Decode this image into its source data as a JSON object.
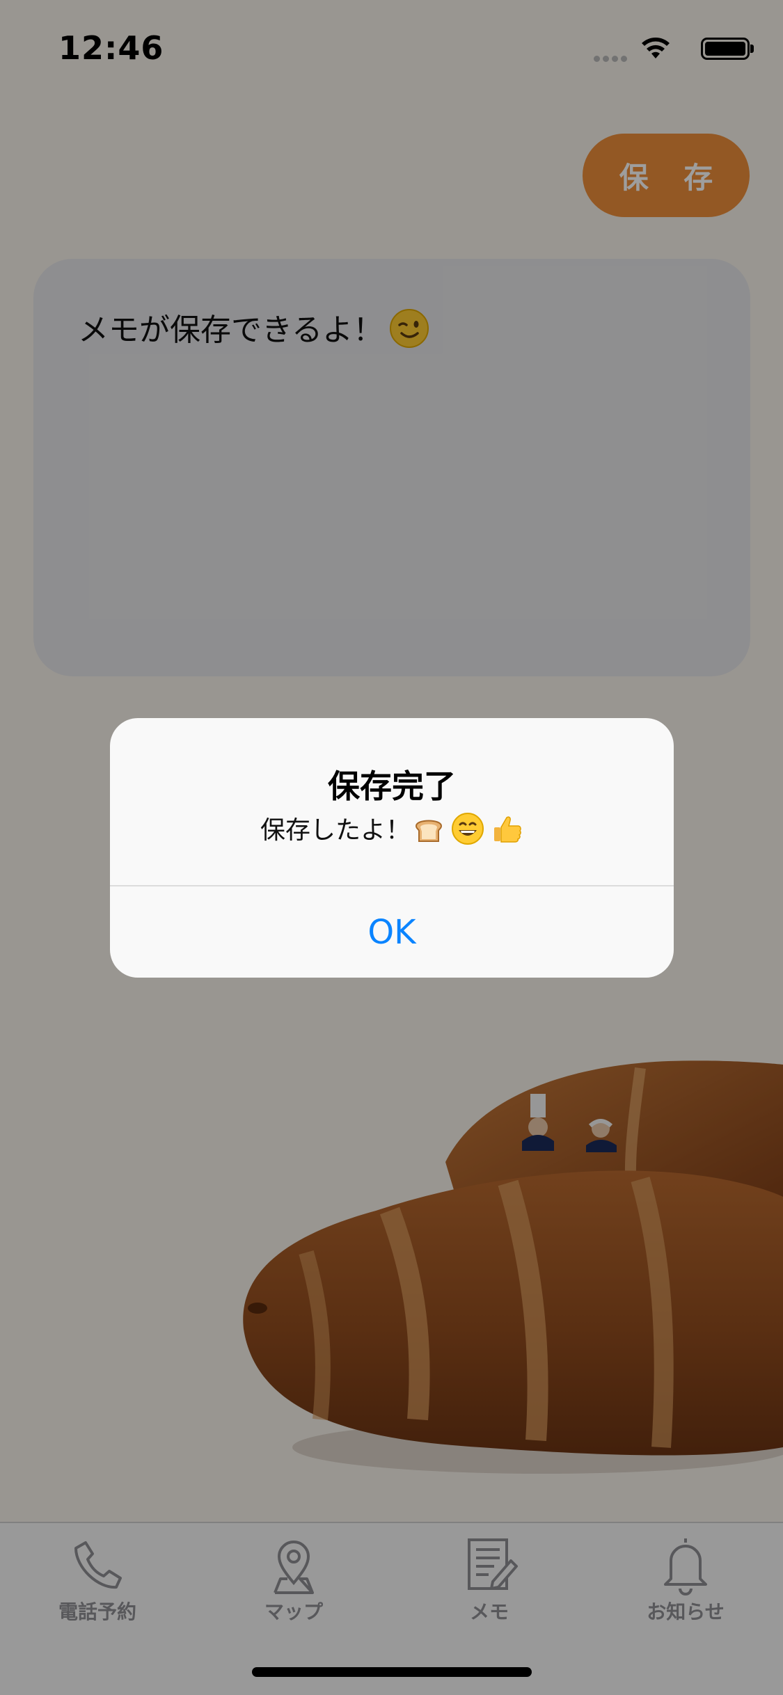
{
  "status_bar": {
    "time": "12:46",
    "icons": [
      "signal-icon",
      "wifi-icon",
      "battery-icon"
    ]
  },
  "header": {
    "save_label": "保 存"
  },
  "memo": {
    "text": "メモが保存できるよ！",
    "emoji": "winking-face-emoji"
  },
  "alert": {
    "title": "保存完了",
    "message": "保存したよ！",
    "message_emojis": [
      "bread-emoji",
      "grinning-face-emoji",
      "thumbs-up-emoji"
    ],
    "ok_label": "OK"
  },
  "tab_bar": {
    "items": [
      {
        "label": "電話予約",
        "icon": "phone-icon"
      },
      {
        "label": "マップ",
        "icon": "map-pin-icon"
      },
      {
        "label": "メモ",
        "icon": "memo-icon"
      },
      {
        "label": "お知らせ",
        "icon": "bell-icon"
      }
    ]
  },
  "colors": {
    "accent": "#ED8E3B",
    "link": "#0A84FF",
    "background": "#F7F2EA",
    "memo_box": "#E6E6E9",
    "overlay": "rgba(0,0,0,0.38)"
  }
}
